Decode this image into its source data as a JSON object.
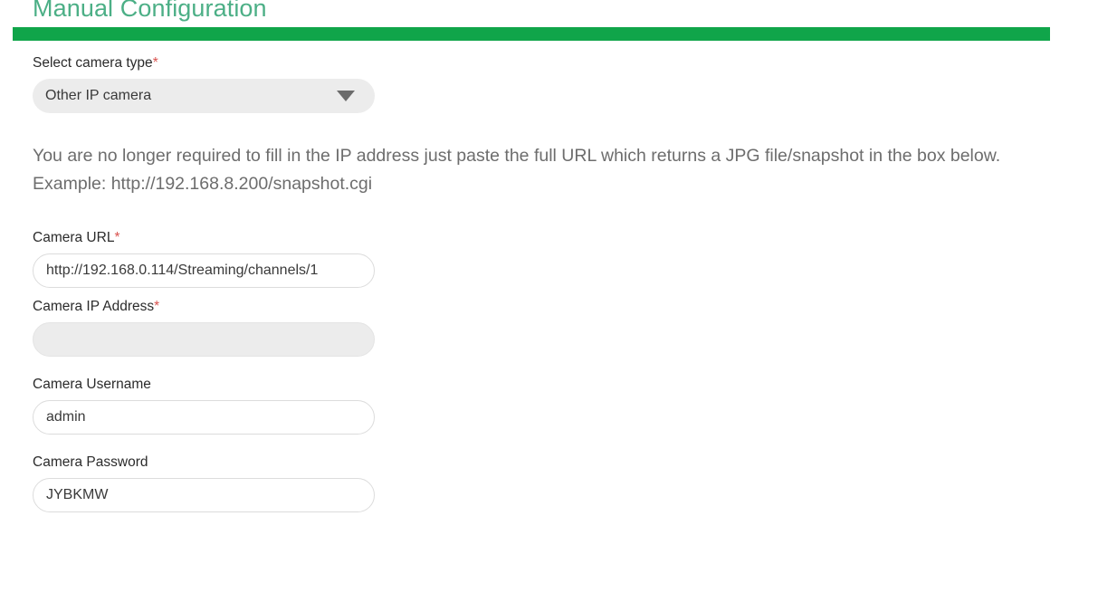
{
  "header": {
    "title": "Manual Configuration",
    "accent_color": "#10a54a",
    "title_color": "#4caf86"
  },
  "form": {
    "camera_type": {
      "label": "Select camera type",
      "required_marker": "*",
      "selected": "Other IP camera",
      "options": [
        "Other IP camera"
      ],
      "dropdown_icon": "chevron-down-icon"
    },
    "helper_text": "You are no longer required to fill in the IP address just paste the full URL which returns a JPG file/snapshot in the box below. Example: http://192.168.8.200/snapshot.cgi",
    "camera_url": {
      "label": "Camera URL",
      "required_marker": "*",
      "value": "http://192.168.0.114/Streaming/channels/1",
      "placeholder": ""
    },
    "camera_ip": {
      "label": "Camera IP Address",
      "required_marker": "*",
      "value": "",
      "placeholder": ""
    },
    "camera_username": {
      "label": "Camera Username",
      "required_marker": "",
      "value": "admin",
      "placeholder": ""
    },
    "camera_password": {
      "label": "Camera Password",
      "required_marker": "",
      "value": "JYBKMW",
      "placeholder": ""
    }
  },
  "colors": {
    "required_asterisk": "#d9534f",
    "label_text": "#2b2b2b",
    "helper_text": "#6d6d6d",
    "input_border": "#dcdcdc",
    "disabled_bg": "#ececec"
  }
}
